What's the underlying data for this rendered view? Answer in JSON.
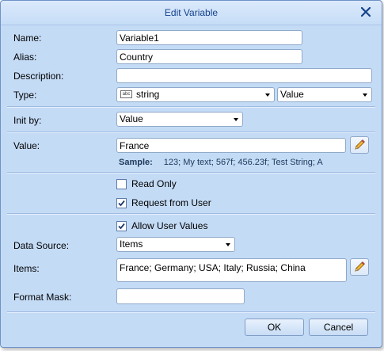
{
  "dialog": {
    "title": "Edit Variable",
    "close_icon": "close-icon"
  },
  "labels": {
    "name": "Name:",
    "alias": "Alias:",
    "description": "Description:",
    "type": "Type:",
    "init_by": "Init by:",
    "value": "Value:",
    "data_source": "Data Source:",
    "items": "Items:",
    "format_mask": "Format Mask:"
  },
  "fields": {
    "name": "Variable1",
    "alias": "Country",
    "description": "",
    "type": "string",
    "type_icon": "abc",
    "type_kind": "Value",
    "init_by": "Value",
    "value": "France",
    "data_source": "Items",
    "items": "France; Germany; USA; Italy; Russia; China",
    "format_mask": ""
  },
  "sample": {
    "label": "Sample:",
    "text": "123; My text; 567f; 456.23f; Test String; A"
  },
  "checkboxes": {
    "read_only": {
      "label": "Read Only",
      "checked": false
    },
    "request_from_user": {
      "label": "Request from User",
      "checked": true
    },
    "allow_user_values": {
      "label": "Allow User Values",
      "checked": true
    }
  },
  "buttons": {
    "ok": "OK",
    "cancel": "Cancel"
  },
  "icons": {
    "edit_value": "pencil-icon",
    "edit_items": "pencil-icon"
  },
  "colors": {
    "background": "#c4dbf6",
    "title_text": "#15428b",
    "border": "#8fa9c9"
  }
}
